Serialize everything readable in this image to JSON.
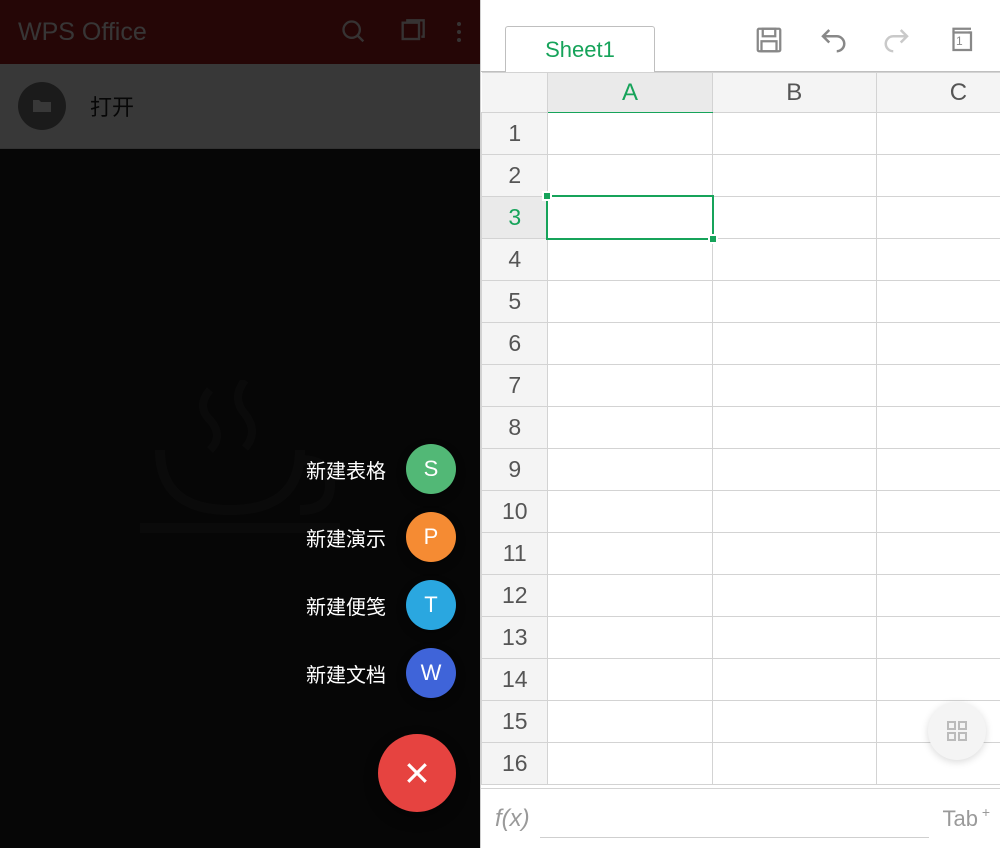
{
  "left": {
    "app_title": "WPS Office",
    "open_label": "打开",
    "fab": {
      "items": [
        {
          "label": "新建表格",
          "icon": "S"
        },
        {
          "label": "新建演示",
          "icon": "P"
        },
        {
          "label": "新建便笺",
          "icon": "T"
        },
        {
          "label": "新建文档",
          "icon": "W"
        }
      ]
    }
  },
  "right": {
    "sheet_tab": "Sheet1",
    "columns": [
      "A",
      "B",
      "C"
    ],
    "rows": [
      "1",
      "2",
      "3",
      "4",
      "5",
      "6",
      "7",
      "8",
      "9",
      "10",
      "11",
      "12",
      "13",
      "14",
      "15",
      "16"
    ],
    "selected_cell": {
      "row": "3",
      "col": "A"
    },
    "fx_label": "f(x)",
    "tab_key": "Tab",
    "copies_badge": "1"
  }
}
